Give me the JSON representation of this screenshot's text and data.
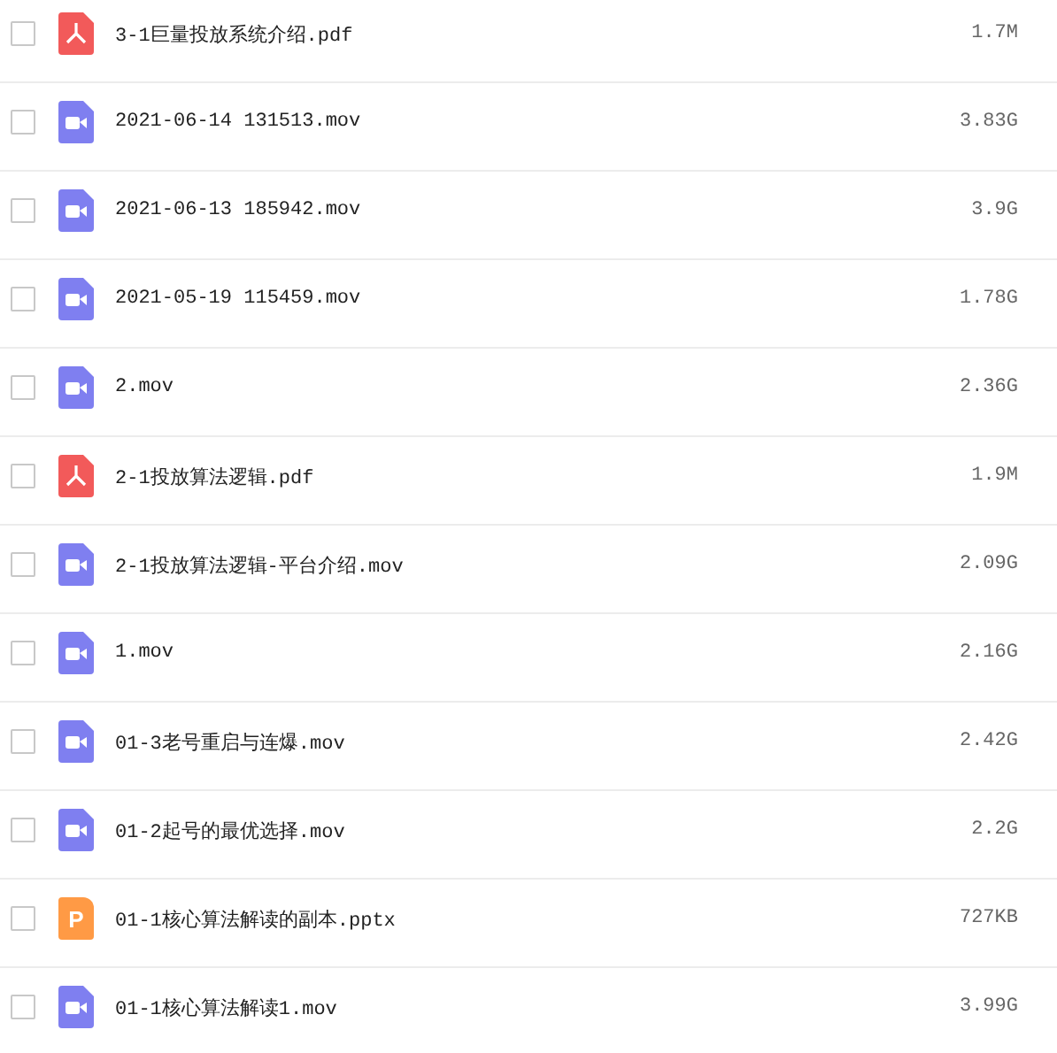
{
  "files": [
    {
      "name": "3-1巨量投放系统介绍.pdf",
      "size": "1.7M",
      "kind": "pdf",
      "checked": false
    },
    {
      "name": "2021-06-14 131513.mov",
      "size": "3.83G",
      "kind": "video",
      "checked": false
    },
    {
      "name": "2021-06-13 185942.mov",
      "size": "3.9G",
      "kind": "video",
      "checked": false
    },
    {
      "name": "2021-05-19 115459.mov",
      "size": "1.78G",
      "kind": "video",
      "checked": false
    },
    {
      "name": "2.mov",
      "size": "2.36G",
      "kind": "video",
      "checked": false
    },
    {
      "name": "2-1投放算法逻辑.pdf",
      "size": "1.9M",
      "kind": "pdf",
      "checked": false
    },
    {
      "name": "2-1投放算法逻辑-平台介绍.mov",
      "size": "2.09G",
      "kind": "video",
      "checked": false
    },
    {
      "name": "1.mov",
      "size": "2.16G",
      "kind": "video",
      "checked": false
    },
    {
      "name": "01-3老号重启与连爆.mov",
      "size": "2.42G",
      "kind": "video",
      "checked": false
    },
    {
      "name": "01-2起号的最优选择.mov",
      "size": "2.2G",
      "kind": "video",
      "checked": false
    },
    {
      "name": "01-1核心算法解读的副本.pptx",
      "size": "727KB",
      "kind": "ppt",
      "icon_letter": "P",
      "checked": false
    },
    {
      "name": "01-1核心算法解读1.mov",
      "size": "3.99G",
      "kind": "video",
      "checked": false
    }
  ]
}
